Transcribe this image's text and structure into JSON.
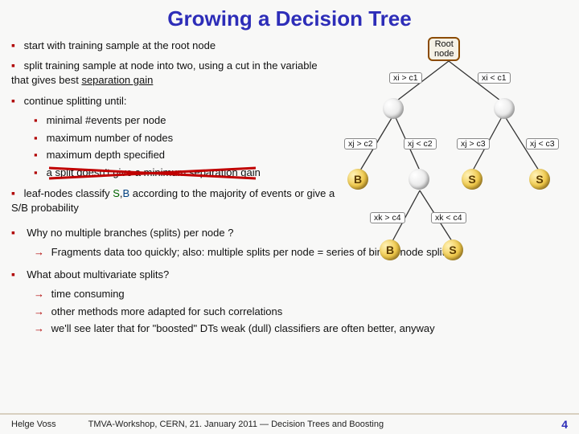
{
  "title": "Growing a Decision Tree",
  "bul": {
    "start": "start with training sample at the root node",
    "split_a": "split training sample at node into two, using a cut in the variable that gives best ",
    "split_b": "separation gain",
    "cont": "continue splitting until:",
    "sub_min": "minimal #events per node",
    "sub_maxn": "maximum number of nodes",
    "sub_maxd": "maximum depth specified",
    "sub_nogain": "a split doesn't give a minimum separation gain",
    "leaf_a": "leaf-nodes classify ",
    "leaf_s": "S",
    "leaf_sep": ",",
    "leaf_b": "B",
    "leaf_c": " according to the majority of events  or give a S/B probability",
    "q1": "Why no multiple branches (splits) per node ?",
    "q1a": "Fragments data too quickly; also: multiple splits per node = series of binary node splits",
    "q2": "What about multivariate splits?",
    "q2a1": "time consuming",
    "q2a2": "other methods more adapted for such correlations",
    "q2a3": "we'll see later that for \"boosted\" DTs weak (dull) classifiers are often better, anyway"
  },
  "tree": {
    "root": "Root\nnode",
    "c1l": "xi > c1",
    "c1r": "xi < c1",
    "c2l": "xj > c2",
    "c2r": "xj < c2",
    "c3l": "xj > c3",
    "c3r": "xj < c3",
    "c4l": "xk > c4",
    "c4r": "xk < c4",
    "B": "B",
    "S": "S"
  },
  "footer": {
    "author": "Helge Voss",
    "venue": "TMVA-Workshop, CERN,  21. January 2011  ― Decision Trees and Boosting",
    "page": "4"
  },
  "chart_data": {
    "type": "diagram",
    "note": "Binary decision tree schematic (illustrative, not numeric data)",
    "nodes": [
      {
        "id": "root",
        "label": "Root node"
      },
      {
        "id": "n1",
        "split_left": "xi > c1",
        "split_right": "xi < c1"
      },
      {
        "id": "n2l",
        "split_left": "xj > c2",
        "split_right": "xj < c2"
      },
      {
        "id": "n2r",
        "split_left": "xj > c3",
        "split_right": "xj < c3"
      },
      {
        "id": "leaf_B1",
        "class": "B"
      },
      {
        "id": "leaf_S1",
        "class": "S"
      },
      {
        "id": "leaf_S2",
        "class": "S"
      },
      {
        "id": "n3",
        "split_left": "xk > c4",
        "split_right": "xk < c4"
      },
      {
        "id": "leaf_B2",
        "class": "B"
      },
      {
        "id": "leaf_S3",
        "class": "S"
      }
    ]
  }
}
